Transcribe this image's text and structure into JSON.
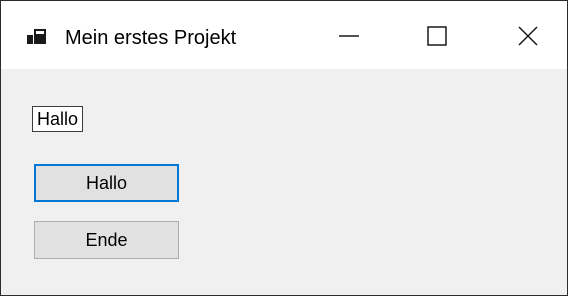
{
  "window": {
    "title": "Mein erstes Projekt"
  },
  "caption_buttons": {
    "minimize_icon": "minimize-icon",
    "maximize_icon": "maximize-icon",
    "close_icon": "close-icon"
  },
  "form": {
    "label_text": "Hallo",
    "button_hallo_label": "Hallo",
    "button_ende_label": "Ende"
  },
  "colors": {
    "focus_border": "#0078d7",
    "button_face": "#e1e1e1",
    "form_background": "#f0f0f0"
  }
}
